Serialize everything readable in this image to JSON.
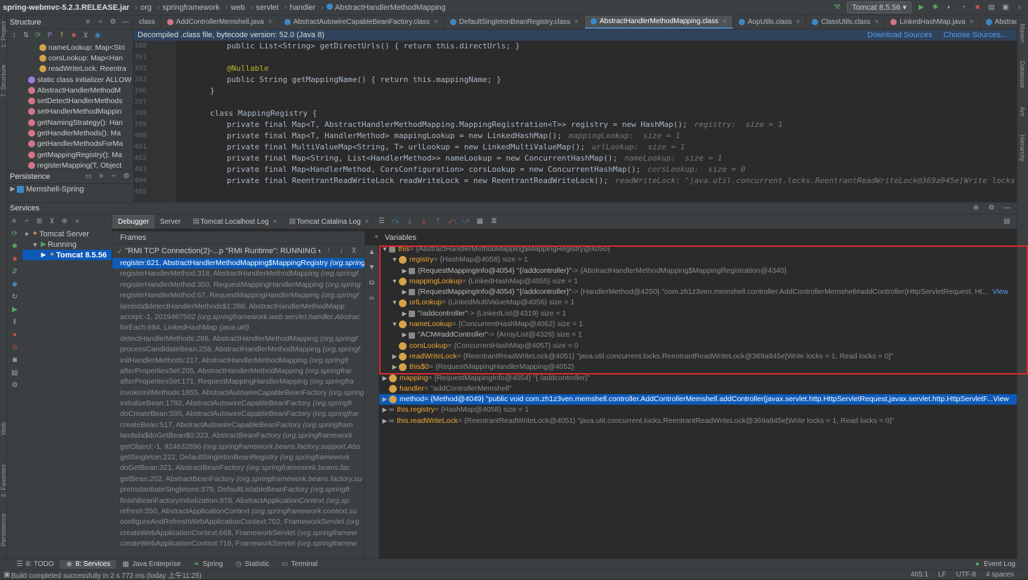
{
  "breadcrumbs": [
    "spring-webmvc-5.2.3.RELEASE.jar",
    "org",
    "springframework",
    "web",
    "servlet",
    "handler",
    "AbstractHandlerMethodMapping"
  ],
  "run_config": "Tomcat 8.5.56",
  "tabs": [
    {
      "label": "class"
    },
    {
      "label": "AddControllerMemshell.java"
    },
    {
      "label": "AbstractAutowireCapableBeanFactory.class"
    },
    {
      "label": "DefaultSingletonBeanRegistry.class"
    },
    {
      "label": "AbstractHandlerMethodMapping.class",
      "active": true
    },
    {
      "label": "AopUtils.class"
    },
    {
      "label": "ClassUtils.class"
    },
    {
      "label": "LinkedHashMap.java"
    },
    {
      "label": "AbstractBeanFactory.class"
    }
  ],
  "banner": {
    "text": "Decompiled .class file, bytecode version: 52.0 (Java 8)",
    "download": "Download Sources",
    "choose": "Choose Sources..."
  },
  "structure": {
    "title": "Structure",
    "items": [
      {
        "label": "nameLookup: Map<Stri",
        "kind": "f"
      },
      {
        "label": "corsLookup: Map<Han",
        "kind": "f"
      },
      {
        "label": "readWriteLock: Reentra",
        "kind": "f"
      },
      {
        "label": "static class initializer ALLOW",
        "kind": "s"
      },
      {
        "label": "AbstractHandlerMethodM",
        "kind": "m"
      },
      {
        "label": "setDetectHandlerMethods",
        "kind": "m"
      },
      {
        "label": "setHandlerMethodMappin",
        "kind": "m"
      },
      {
        "label": "getNamingStrategy(): Han",
        "kind": "m"
      },
      {
        "label": "getHandlerMethods(): Ma",
        "kind": "m"
      },
      {
        "label": "getHandlerMethodsForMa",
        "kind": "m"
      },
      {
        "label": "getMappingRegistry(): Ma",
        "kind": "m"
      },
      {
        "label": "registerMapping(T, Object",
        "kind": "m"
      }
    ]
  },
  "persistence": {
    "title": "Persistence",
    "item": "Memshell-Spring"
  },
  "line_numbers": [
    "388",
    "391",
    "392",
    "393",
    "396",
    "397",
    "398",
    "399",
    "400",
    "401",
    "402",
    "403",
    "404",
    "485"
  ],
  "code_lines": [
    "public List<String> getDirectUrls() { return this.directUrls; }",
    "",
    "@Nullable",
    "public String getMappingName() { return this.mappingName; }",
    "}",
    "",
    "class MappingRegistry {",
    "private final Map<T, AbstractHandlerMethodMapping.MappingRegistration<T>> registry = new HashMap();",
    "private final Map<T, HandlerMethod> mappingLookup = new LinkedHashMap();",
    "private final MultiValueMap<String, T> urlLookup = new LinkedMultiValueMap();",
    "private final Map<String, List<HandlerMethod>> nameLookup = new ConcurrentHashMap();",
    "private final Map<HandlerMethod, CorsConfiguration> corsLookup = new ConcurrentHashMap();",
    "private final ReentrantReadWriteLock readWriteLock = new ReentrantReadWriteLock();",
    ""
  ],
  "code_hints": [
    "",
    "",
    "",
    "",
    "",
    "",
    "",
    "registry:  size = 1",
    "mappingLookup:  size = 1",
    "urlLookup:  size = 1",
    "nameLookup:  size = 1",
    "corsLookup:  size = 0",
    "readWriteLock: \"java.util.concurrent.locks.ReentrantReadWriteLock@369a945e[Write locks = 1, Read locks =",
    ""
  ],
  "services": {
    "title": "Services",
    "tree": [
      "Tomcat Server",
      "Running",
      "Tomcat 8.5.56"
    ],
    "tabs": [
      "Debugger",
      "Server",
      "Tomcat Localhost Log",
      "Tomcat Catalina Log"
    ]
  },
  "frames": {
    "title": "Frames",
    "thread": "\"RMI TCP Connection(2)-...p \"RMI Runtime\": RUNNING",
    "items": [
      {
        "m": "register:621, AbstractHandlerMethodMapping$MappingRegistry ",
        "p": "(org.spring"
      },
      {
        "m": "registerHandlerMethod:318, AbstractHandlerMethodMapping ",
        "p": "(org.springf"
      },
      {
        "m": "registerHandlerMethod:350, RequestMappingHandlerMapping ",
        "p": "(org.spring"
      },
      {
        "m": "registerHandlerMethod:67, RequestMappingHandlerMapping ",
        "p": "(org.springf"
      },
      {
        "m": "lambda$detectHandlerMethods$1:288, AbstractHandlerMethodMapp",
        "p": ""
      },
      {
        "m": "accept:-1, 2019467502 ",
        "p": "(org.springframework.web.servlet.handler.Abstrac"
      },
      {
        "m": "forEach:684, LinkedHashMap ",
        "p": "(java.util)"
      },
      {
        "m": "detectHandlerMethods:286, AbstractHandlerMethodMapping ",
        "p": "(org.springf"
      },
      {
        "m": "processCandidateBean:258, AbstractHandlerMethodMapping ",
        "p": "(org.springf"
      },
      {
        "m": "initHandlerMethods:217, AbstractHandlerMethodMapping ",
        "p": "(org.springfr"
      },
      {
        "m": "afterPropertiesSet:205, AbstractHandlerMethodMapping ",
        "p": "(org.springfrar"
      },
      {
        "m": "afterPropertiesSet:171, RequestMappingHandlerMapping ",
        "p": "(org.springfra"
      },
      {
        "m": "invokeInitMethods:1855, AbstractAutowireCapableBeanFactory ",
        "p": "(org.spring"
      },
      {
        "m": "initializeBean:1792, AbstractAutowireCapableBeanFactory ",
        "p": "(org.springfr"
      },
      {
        "m": "doCreateBean:595, AbstractAutowireCapableBeanFactory ",
        "p": "(org.springfrar"
      },
      {
        "m": "createBean:517, AbstractAutowireCapableBeanFactory ",
        "p": "(org.springfram"
      },
      {
        "m": "lambda$doGetBean$0:323, AbstractBeanFactory ",
        "p": "(org.springframework"
      },
      {
        "m": "getObject:-1, 924632896 ",
        "p": "(org.springframework.beans.factory.support.Abs"
      },
      {
        "m": "getSingleton:222, DefaultSingletonBeanRegistry ",
        "p": "(org.springframework"
      },
      {
        "m": "doGetBean:321, AbstractBeanFactory ",
        "p": "(org.springframework.beans.fac"
      },
      {
        "m": "getBean:202, AbstractBeanFactory ",
        "p": "(org.springframework.beans.factory.su"
      },
      {
        "m": "preInstantiateSingletons:879, DefaultListableBeanFactory ",
        "p": "(org.springfr"
      },
      {
        "m": "finishBeanFactoryInitialization:878, AbstractApplicationContext ",
        "p": "(org.sp"
      },
      {
        "m": "refresh:550, AbstractApplicationContext ",
        "p": "(org.springframework.context.su"
      },
      {
        "m": "configureAndRefreshWebApplicationContext:702, FrameworkServlet ",
        "p": "(org"
      },
      {
        "m": "createWebApplicationContext:668, FrameworkServlet ",
        "p": "(org.springframew"
      },
      {
        "m": "createWebApplicationContext:716, FrameworkServlet ",
        "p": "(org.springframew"
      }
    ]
  },
  "variables": {
    "title": "Variables",
    "rows": [
      {
        "indent": 0,
        "arrow": "▼",
        "icon": "p",
        "name": "this",
        "val": " = {AbstractHandlerMethodMapping$MappingRegistry@4050}"
      },
      {
        "indent": 1,
        "arrow": "▼",
        "icon": "o",
        "name": "registry",
        "val": " = {HashMap@4058}  size = 1"
      },
      {
        "indent": 2,
        "arrow": "▶",
        "icon": "p",
        "name": "{RequestMappingInfo@4054} \"{/addcontroller}\"",
        "val": " -> {AbstractHandlerMethodMapping$MappingRegistration@4340}"
      },
      {
        "indent": 1,
        "arrow": "▼",
        "icon": "o",
        "name": "mappingLookup",
        "val": " = {LinkedHashMap@4055}  size = 1"
      },
      {
        "indent": 2,
        "arrow": "▶",
        "icon": "p",
        "name": "{RequestMappingInfo@4054} \"{/addcontroller}\"",
        "val": " -> {HandlerMethod@4250} \"com.zh1z3ven.memshell.controller.AddControllerMemshell#addController(HttpServletRequest, Ht...",
        "view": "View"
      },
      {
        "indent": 1,
        "arrow": "▼",
        "icon": "o",
        "name": "urlLookup",
        "val": " = {LinkedMultiValueMap@4056}  size = 1"
      },
      {
        "indent": 2,
        "arrow": "▶",
        "icon": "p",
        "name": "\"/addcontroller\"",
        "val": " -> {LinkedList@4319}  size = 1"
      },
      {
        "indent": 1,
        "arrow": "▼",
        "icon": "o",
        "name": "nameLookup",
        "val": " = {ConcurrentHashMap@4062}  size = 1"
      },
      {
        "indent": 2,
        "arrow": "▶",
        "icon": "p",
        "name": "\"ACM#addController\"",
        "val": " -> {ArrayList@4326}  size = 1"
      },
      {
        "indent": 1,
        "arrow": "",
        "icon": "o",
        "name": "corsLookup",
        "val": " = {ConcurrentHashMap@4057}  size = 0"
      },
      {
        "indent": 1,
        "arrow": "▶",
        "icon": "o",
        "name": "readWriteLock",
        "val": " = {ReentrantReadWriteLock@4051} \"java.util.concurrent.locks.ReentrantReadWriteLock@369a945e[Write locks = 1, Read locks = 0]\""
      },
      {
        "indent": 1,
        "arrow": "▶",
        "icon": "o",
        "name": "this$0",
        "val": " = {RequestMappingHandlerMapping@4052}"
      },
      {
        "indent": 0,
        "arrow": "▶",
        "icon": "o",
        "name": "mapping",
        "val": " = {RequestMappingInfo@4054} \"{ /addcontroller}\""
      },
      {
        "indent": 0,
        "arrow": "",
        "icon": "o",
        "name": "handler",
        "val": " = \"addControllerMemshell\""
      },
      {
        "indent": 0,
        "arrow": "▶",
        "icon": "o",
        "name": "method",
        "val": " = {Method@4049} \"public void com.zh1z3ven.memshell.controller.AddControllerMemshell.addController(javax.servlet.http.HttpServletRequest,javax.servlet.http.HttpServletF...",
        "view": "View",
        "sel": true
      },
      {
        "indent": 0,
        "arrow": "▶",
        "icon": "oo",
        "name": "this.registry",
        "val": " = {HashMap@4058}  size = 1"
      },
      {
        "indent": 0,
        "arrow": "▶",
        "icon": "oo",
        "name": "this.readWriteLock",
        "val": " = {ReentrantReadWriteLock@4051} \"java.util.concurrent.locks.ReentrantReadWriteLock@369a945e[Write locks = 1, Read locks = 0]\""
      }
    ]
  },
  "bottom_tabs": [
    "6: TODO",
    "8: Services",
    "Java Enterprise",
    "Spring",
    "Statistic",
    "Terminal"
  ],
  "event_log": "Event Log",
  "status": {
    "text": "Build completed successfully in 2 s 772 ms (today 上午11:25)",
    "pos": "465:1",
    "le": "LF",
    "enc": "UTF-8",
    "indent": "4 spaces"
  }
}
